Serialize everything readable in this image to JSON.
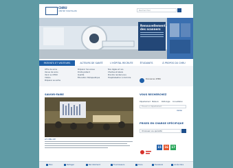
{
  "header": {
    "logo_title": "CHRU",
    "logo_subtitle": "CENTRE HOSPITALIER",
    "search_placeholder": "Rechercher"
  },
  "hero": {
    "card_title": "Renouvellement des scanners"
  },
  "nav": {
    "tabs": [
      {
        "label": "PATIENTS ET VISITEURS",
        "active": true
      },
      {
        "label": "ACTEURS DE SANTÉ",
        "active": false
      },
      {
        "label": "L'HÔPITAL RECRUTE",
        "active": false
      },
      {
        "label": "ÉTUDIANTS",
        "active": false
      },
      {
        "label": "À PROPOS DU CHRU",
        "active": false
      }
    ]
  },
  "menu": {
    "col1": [
      "Offre de soins",
      "Venue de soins",
      "Venir au CHRU",
      "Vidéos",
      "Préparer sa sortie"
    ],
    "col2": [
      "Préparer ma venue",
      "Droits patient",
      "Qualité",
      "Éducation thérapeutique"
    ],
    "col3": [
      "Nos règles et nos",
      "Chartes et labels",
      "Prendre rendez-vous",
      "Hospitalisation à domicile"
    ],
    "donor_text": "Donnez au CHRU"
  },
  "news": {
    "section_title": "SAVOIR-FAIRE",
    "caption": "LE CHRU DE"
  },
  "sidebar_right": {
    "search_title": "VOUS RECHERCHEZ",
    "search_tabs": [
      "Département",
      "Médecin",
      "Pathologie",
      "Consultation"
    ],
    "search_placeholder": "Trouver un département",
    "search_link": "Valider",
    "specialties_title": "PRISES EN CHARGE SPÉCIFIQUE",
    "select_value": "Choisissez une spécialité",
    "badges": [
      {
        "label": "15",
        "color": "#1e5fa8"
      },
      {
        "label": "16",
        "color": "#e4572e"
      },
      {
        "label": "17",
        "color": "#2aa65a"
      }
    ]
  },
  "footer": {
    "items": [
      "Plan",
      "Partager",
      "Recrutement",
      "Fournisseurs",
      "Dons",
      "Facebook",
      "Accès libre"
    ]
  }
}
